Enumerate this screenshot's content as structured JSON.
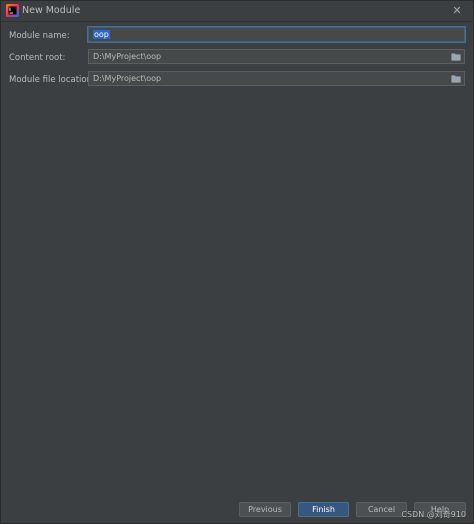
{
  "window": {
    "title": "New Module",
    "close_glyph": "✕",
    "app_icon": "intellij-idea-icon"
  },
  "form": {
    "module_name_label": "Module name:",
    "module_name_value": "oop",
    "content_root_label": "Content root:",
    "content_root_value": "D:\\MyProject\\oop",
    "module_file_location_label": "Module file location:",
    "module_file_location_value": "D:\\MyProject\\oop",
    "browse_icon": "folder-icon"
  },
  "footer": {
    "previous_label": "Previous",
    "finish_label": "Finish",
    "cancel_label": "Cancel",
    "help_label": "Help"
  },
  "watermark": {
    "text": "CSDN @刘奇910"
  },
  "colors": {
    "background": "#3c3f41",
    "field_background": "#45494a",
    "text": "#bbbbbb",
    "selection": "#2f65ca",
    "primary_button": "#365880"
  }
}
